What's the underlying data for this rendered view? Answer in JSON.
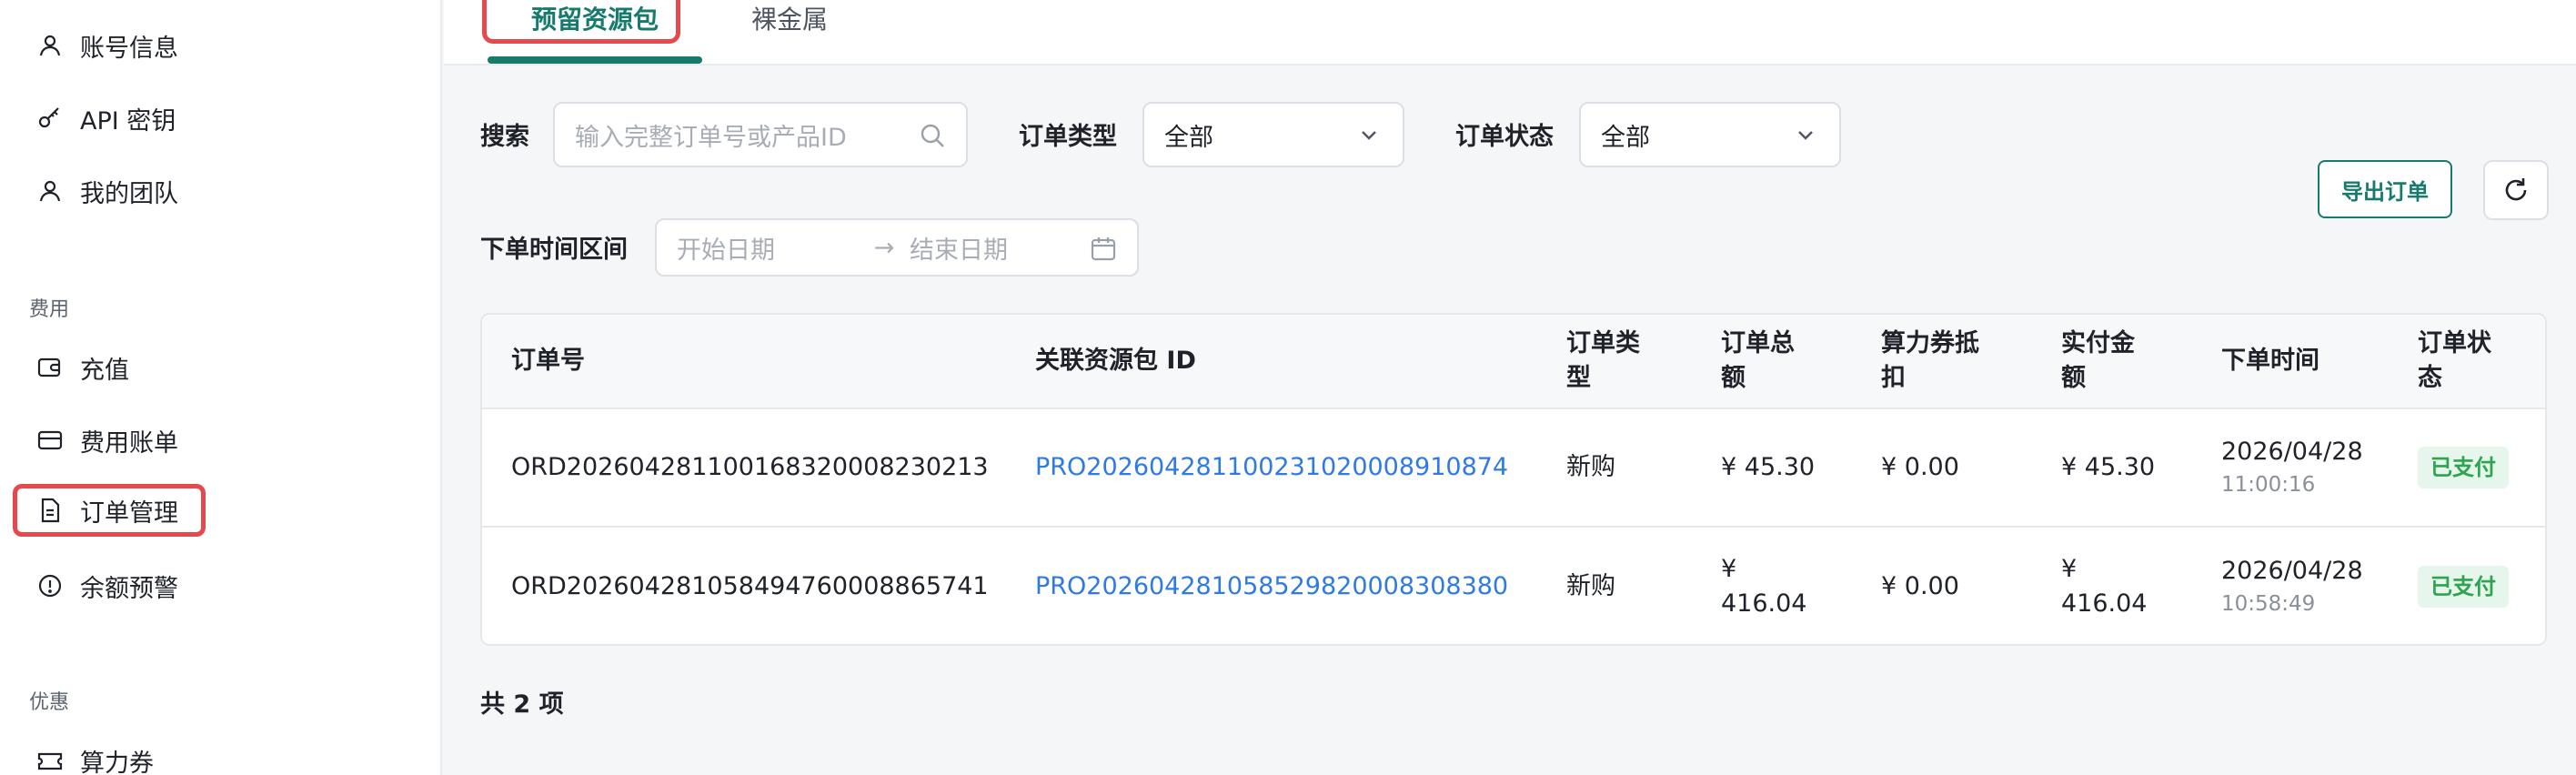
{
  "sidebar": {
    "items_top": [
      {
        "label": "账号信息",
        "icon": "user-icon"
      },
      {
        "label": "API 密钥",
        "icon": "key-icon"
      },
      {
        "label": "我的团队",
        "icon": "team-icon"
      }
    ],
    "group_fee": "费用",
    "items_fee": [
      {
        "label": "充值",
        "icon": "wallet-icon"
      },
      {
        "label": "费用账单",
        "icon": "card-icon"
      },
      {
        "label": "订单管理",
        "icon": "document-icon"
      },
      {
        "label": "余额预警",
        "icon": "alert-icon"
      }
    ],
    "group_promo": "优惠",
    "items_promo": [
      {
        "label": "算力券",
        "icon": "ticket-icon"
      }
    ]
  },
  "tabs": [
    {
      "label": "预留资源包",
      "active": true
    },
    {
      "label": "裸金属",
      "active": false
    }
  ],
  "filters": {
    "search_label": "搜索",
    "search_placeholder": "输入完整订单号或产品ID",
    "order_type_label": "订单类型",
    "order_type_value": "全部",
    "order_status_label": "订单状态",
    "order_status_value": "全部",
    "time_range_label": "下单时间区间",
    "start_placeholder": "开始日期",
    "range_arrow": "→",
    "end_placeholder": "结束日期"
  },
  "actions": {
    "export_label": "导出订单",
    "refresh_icon": "refresh-icon"
  },
  "table": {
    "headers": {
      "order_no": "订单号",
      "package_id": "关联资源包 ID",
      "order_type": [
        "订单类",
        "型"
      ],
      "order_total": [
        "订单总",
        "额"
      ],
      "coupon": [
        "算力券抵",
        "扣"
      ],
      "paid": [
        "实付金",
        "额"
      ],
      "order_time": "下单时间",
      "status": [
        "订单状",
        "态"
      ]
    },
    "rows": [
      {
        "order_no": "ORD20260428110016832000823021​3",
        "package_id": "PRO20260428110023102000891087 4",
        "order_type": "新购",
        "order_total": [
          "¥ 45.30"
        ],
        "coupon": "¥ 0.00",
        "paid": [
          "¥ 45.30"
        ],
        "date": "2026/04/28",
        "time": "11:00:16",
        "status": "已支付"
      },
      {
        "order_no": "ORD20260428105849476000886574 1",
        "package_id": "PRO20260428105852982000830838 0",
        "order_type": "新购",
        "order_total": [
          "¥",
          "416.04"
        ],
        "coupon": "¥ 0.00",
        "paid": [
          "¥",
          "416.04"
        ],
        "date": "2026/04/28",
        "time": "10:58:49",
        "status": "已支付"
      }
    ]
  },
  "footer": {
    "total": "共 2 项"
  },
  "colors": {
    "accent": "#167a6d",
    "link": "#2f7ae5",
    "highlight": "#e5484d",
    "success": "#2da44e"
  }
}
